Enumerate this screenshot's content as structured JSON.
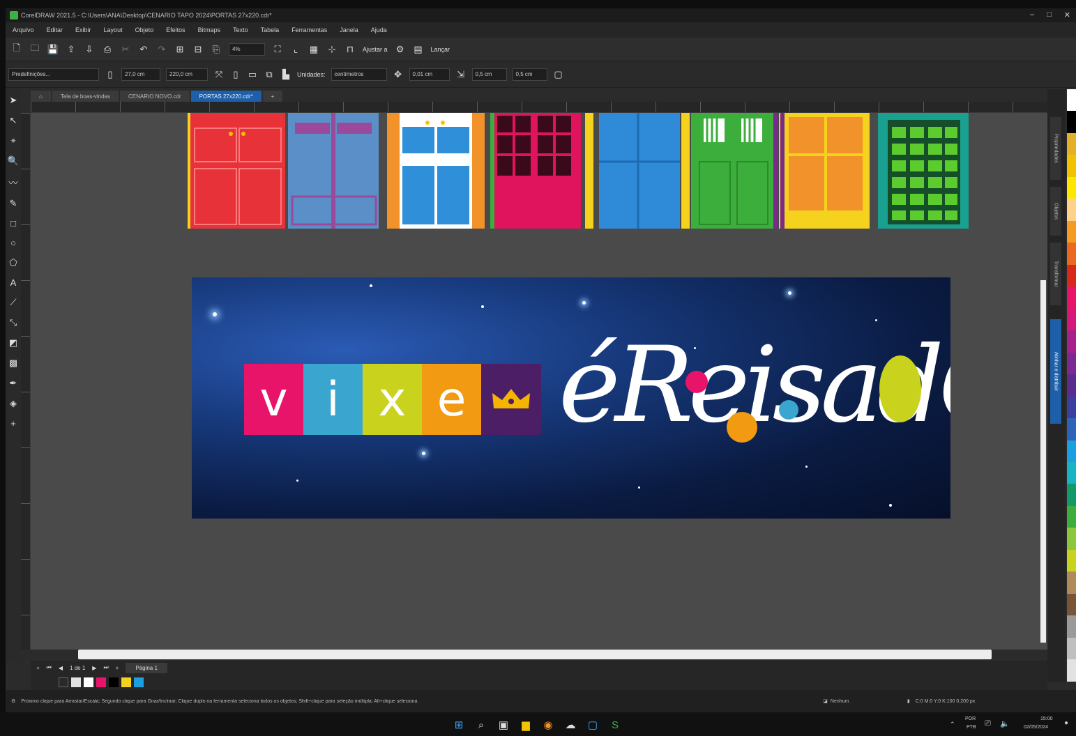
{
  "window": {
    "title": "CorelDRAW 2021.5 - C:\\Users\\ANA\\Desktop\\CENARIO TAPO 2024\\PORTAS 27x220.cdr*",
    "controls": [
      "–",
      "□",
      "✕"
    ]
  },
  "menu": {
    "items": [
      "Arquivo",
      "Editar",
      "Exibir",
      "Layout",
      "Objeto",
      "Efeitos",
      "Bitmaps",
      "Texto",
      "Tabela",
      "Ferramentas",
      "Janela",
      "Ajuda"
    ]
  },
  "standard_toolbar": {
    "zoom_value": "4%",
    "snap_label": "Ajustar a",
    "launch_label": "Lançar"
  },
  "property_bar": {
    "preset_label": "Predefinições...",
    "width_value": "27,0 cm",
    "height_value": "220,0 cm",
    "units_label": "Unidades:",
    "units_value": "centímetros",
    "nudge_value": "0,01 cm",
    "dup_x": "0,5 cm",
    "dup_y": "0,5 cm"
  },
  "document_tabs": [
    {
      "label": "Tela de boas-vindas",
      "active": false
    },
    {
      "label": "CENARIO NOVO.cdr",
      "active": false
    },
    {
      "label": "PORTAS 27x220.cdr*",
      "active": true
    }
  ],
  "banner": {
    "vixe_letters": [
      "v",
      "i",
      "x",
      "e"
    ],
    "vixe_colors": [
      "#e8146a",
      "#3aa6cf",
      "#c9d31e",
      "#f19a12",
      "#4b1e66"
    ],
    "crown_icon": "crown-icon",
    "reisado_text": "éReisadO"
  },
  "doors": {
    "colors": [
      "#e8323a",
      "#5a8fc7",
      "#2f8fd8",
      "#e0145c",
      "#2f8ad8",
      "#3cae3c",
      "#f2922a",
      "#1aa091"
    ]
  },
  "page_nav": {
    "page_counter": "1 de 1",
    "page_tab": "Página 1"
  },
  "status": {
    "hint": "Próximo clique para Arrastar/Escala; Segundo clique para Girar/Inclinar; Clique duplo na ferramenta seleciona todos os objetos; Shift+clique para seleção múltipla; Alt+clique seleciona",
    "fill_label": "Nenhum",
    "color_profile": "C:0 M:0 Y:0 K:100  0,200 px"
  },
  "taskbar": {
    "lang": "POR",
    "lang_sub": "PTB",
    "time": "15:00",
    "date": "02/05/2024"
  },
  "right_dock": {
    "tabs": [
      "Propriedades",
      "Objetos",
      "Transformar",
      "Alinhar e distribuir"
    ]
  },
  "palette": [
    "#ffffff",
    "#000000",
    "#e4b028",
    "#f2c200",
    "#ffe600",
    "#ffd28a",
    "#f59a22",
    "#e96a1e",
    "#d8281c",
    "#e8146a",
    "#d6187a",
    "#a8208a",
    "#7c2a92",
    "#5a2c8e",
    "#3a3fa0",
    "#2e64b8",
    "#1aa0e0",
    "#17b4c4",
    "#149a6a",
    "#3cae3c",
    "#8cc63f",
    "#c9d31e",
    "#b08a5a",
    "#7a5436",
    "#9a9a9a",
    "#bfbfbf",
    "#e2e2e2"
  ]
}
